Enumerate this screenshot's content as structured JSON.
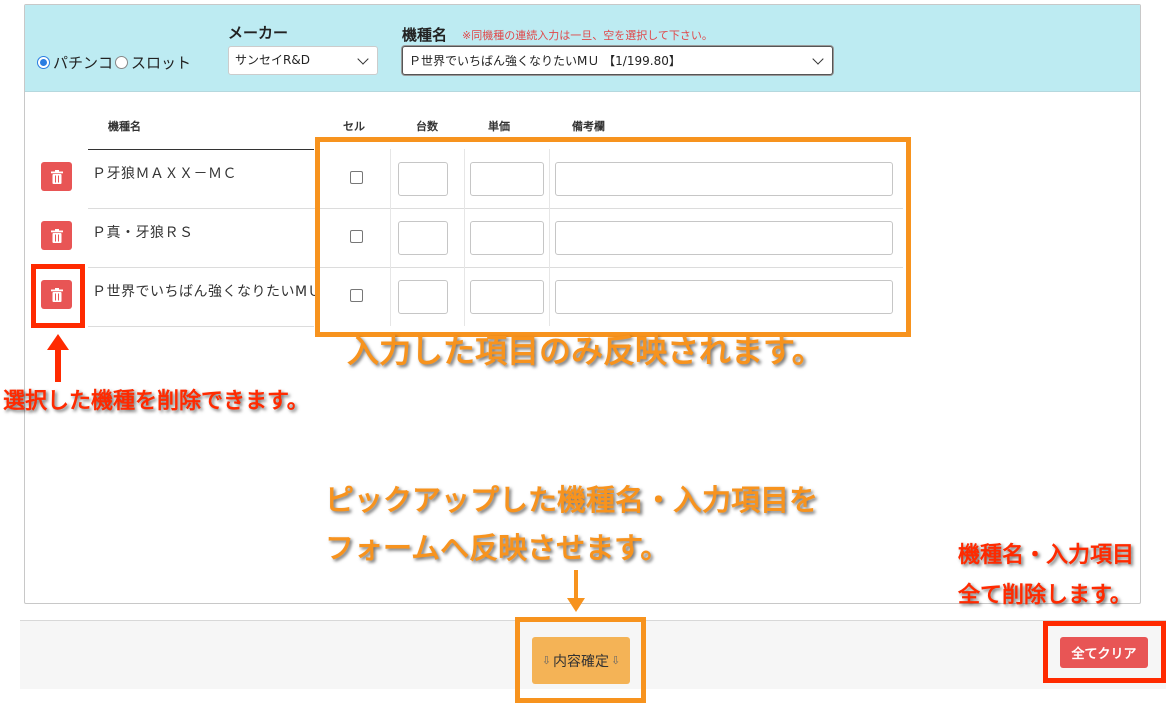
{
  "selector": {
    "radio_pachinko": "パチンコ",
    "radio_slot": "スロット",
    "maker_label": "メーカー",
    "maker_value": "サンセイR&D",
    "model_label": "機種名",
    "model_note": "※同機種の連続入力は一旦、空を選択して下さい。",
    "model_value": "Ｐ世界でいちばん強くなりたいMＵ 【1/199.80】"
  },
  "table": {
    "headers": {
      "name": "機種名",
      "cell": "セル",
      "count": "台数",
      "price": "単価",
      "remarks": "備考欄"
    },
    "rows": [
      {
        "name": "Ｐ牙狼ＭＡＸＸ－ＭＣ"
      },
      {
        "name": "Ｐ真・牙狼ＲＳ"
      },
      {
        "name": "Ｐ世界でいちばん強くなりたいMＵ"
      }
    ]
  },
  "footer": {
    "confirm_label": "内容確定",
    "clear_label": "全てクリア"
  },
  "annotations": {
    "inputs_note": "入力した項目のみ反映されます。",
    "delete_note": "選択した機種を削除できます。",
    "confirm_note_line1": "ピックアップした機種名・入力項目を",
    "confirm_note_line2": "フォームへ反映させます。",
    "clear_note_line1": "機種名・入力項目",
    "clear_note_line2": "全て削除します。"
  },
  "colors": {
    "header_bg": "#bdebf2",
    "danger": "#e85555",
    "confirm": "#f4b356",
    "annotation_orange": "#f7931e",
    "annotation_red": "#ff2a00"
  }
}
